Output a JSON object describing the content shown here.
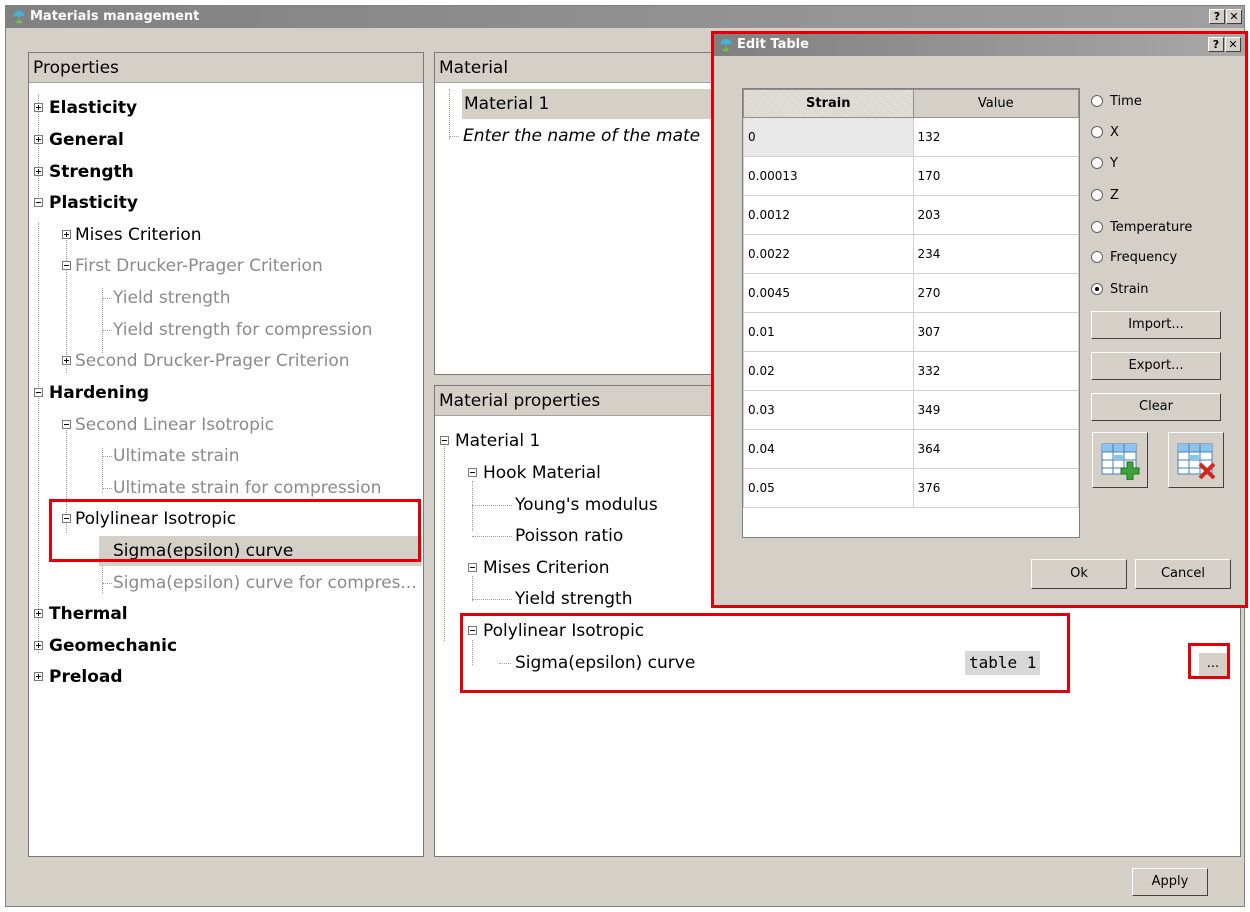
{
  "window": {
    "title": "Materials management",
    "help_label": "?",
    "close_label": "✕"
  },
  "properties_panel": {
    "header": "Properties",
    "items": [
      {
        "label": "Elasticity"
      },
      {
        "label": "General"
      },
      {
        "label": "Strength"
      },
      {
        "label": "Plasticity"
      },
      {
        "label": "Mises Criterion"
      },
      {
        "label": "First Drucker-Prager Criterion"
      },
      {
        "label": "Yield strength"
      },
      {
        "label": "Yield strength for compression"
      },
      {
        "label": "Second Drucker-Prager Criterion"
      },
      {
        "label": "Hardening"
      },
      {
        "label": "Second Linear Isotropic"
      },
      {
        "label": "Ultimate strain"
      },
      {
        "label": "Ultimate strain for compression"
      },
      {
        "label": "Polylinear Isotropic"
      },
      {
        "label": "Sigma(epsilon) curve"
      },
      {
        "label": "Sigma(epsilon) curve for compres..."
      },
      {
        "label": "Thermal"
      },
      {
        "label": "Geomechanic"
      },
      {
        "label": "Preload"
      }
    ]
  },
  "material_panel": {
    "header": "Material",
    "name": "Material 1",
    "placeholder": "Enter the name of the mate"
  },
  "material_properties_panel": {
    "header": "Material properties",
    "items": [
      {
        "label": "Material 1"
      },
      {
        "label": "Hook Material"
      },
      {
        "label": "Young's modulus"
      },
      {
        "label": "Poisson ratio"
      },
      {
        "label": "Mises Criterion"
      },
      {
        "label": "Yield strength"
      },
      {
        "label": "Polylinear Isotropic"
      },
      {
        "label": "Sigma(epsilon) curve"
      }
    ],
    "curve_value": "table 1",
    "ellipsis_label": "..."
  },
  "apply_label": "Apply",
  "edit_table": {
    "title": "Edit Table",
    "columns": [
      "Strain",
      "Value"
    ],
    "rows": [
      [
        "0",
        "132"
      ],
      [
        "0.00013",
        "170"
      ],
      [
        "0.0012",
        "203"
      ],
      [
        "0.0022",
        "234"
      ],
      [
        "0.0045",
        "270"
      ],
      [
        "0.01",
        "307"
      ],
      [
        "0.02",
        "332"
      ],
      [
        "0.03",
        "349"
      ],
      [
        "0.04",
        "364"
      ],
      [
        "0.05",
        "376"
      ]
    ],
    "radios": [
      {
        "label": "Time",
        "checked": false
      },
      {
        "label": "X",
        "checked": false
      },
      {
        "label": "Y",
        "checked": false
      },
      {
        "label": "Z",
        "checked": false
      },
      {
        "label": "Temperature",
        "checked": false
      },
      {
        "label": "Frequency",
        "checked": false
      },
      {
        "label": "Strain",
        "checked": true
      }
    ],
    "import_label": "Import...",
    "export_label": "Export...",
    "clear_label": "Clear",
    "ok_label": "Ok",
    "cancel_label": "Cancel",
    "add_row_icon": "table-add-row-icon",
    "delete_row_icon": "table-delete-row-icon"
  },
  "colors": {
    "highlight": "#e0000a",
    "window_bg": "#d4d0c8"
  }
}
